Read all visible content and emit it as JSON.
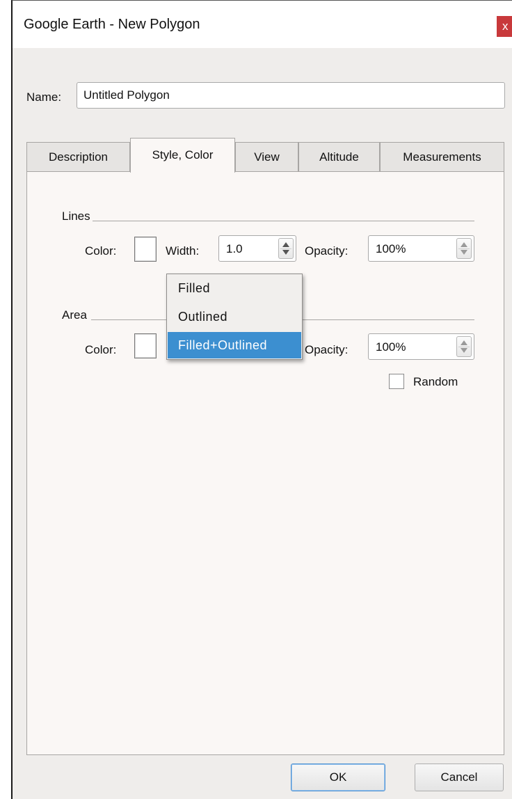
{
  "window": {
    "title": "Google Earth - New Polygon",
    "close_glyph": "x"
  },
  "name_field": {
    "label": "Name:",
    "value": "Untitled Polygon"
  },
  "tabs": [
    {
      "label": "Description",
      "active": false
    },
    {
      "label": "Style, Color",
      "active": true
    },
    {
      "label": "View",
      "active": false
    },
    {
      "label": "Altitude",
      "active": false
    },
    {
      "label": "Measurements",
      "active": false
    }
  ],
  "lines": {
    "group_label": "Lines",
    "color_label": "Color:",
    "color_value": "#ffffff",
    "width_label": "Width:",
    "width_value": "1.0",
    "opacity_label": "Opacity:",
    "opacity_value": "100%"
  },
  "area": {
    "group_label": "Area",
    "color_label": "Color:",
    "color_value": "#ffffff",
    "opacity_label": "Opacity:",
    "opacity_value": "100%",
    "random_label": "Random",
    "random_checked": false
  },
  "fill_mode_dropdown": {
    "options": [
      "Filled",
      "Outlined",
      "Filled+Outlined"
    ],
    "selected": "Filled+Outlined",
    "highlight_color": "#3c8fd0"
  },
  "buttons": {
    "ok": "OK",
    "cancel": "Cancel"
  }
}
